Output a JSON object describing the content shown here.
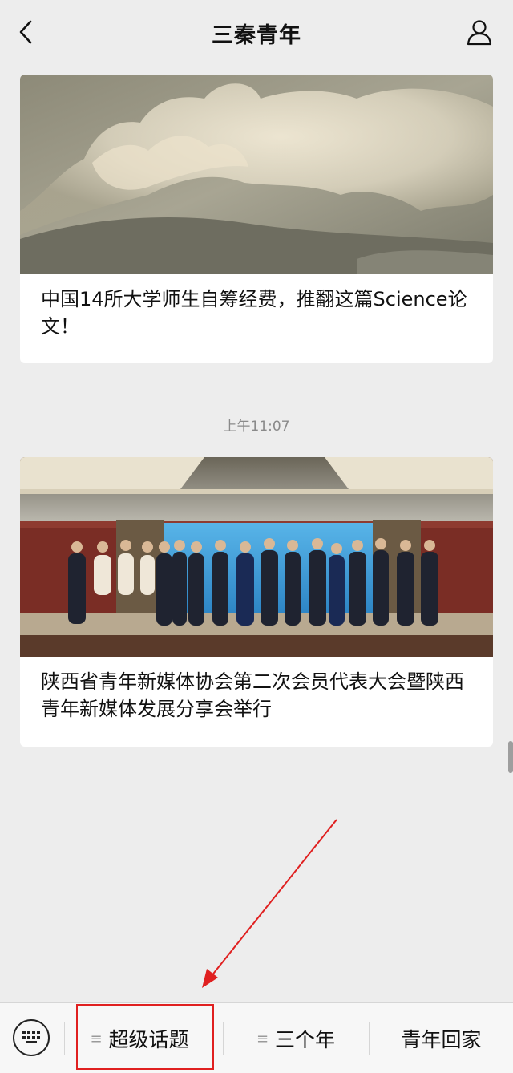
{
  "header": {
    "title": "三秦青年",
    "back_icon": "chevron-left-icon",
    "profile_icon": "person-icon"
  },
  "articles": [
    {
      "title": "中国14所大学师生自筹经费，推翻这篇Science论文！",
      "image": "cloud-photo"
    },
    {
      "title": "陕西省青年新媒体协会第二次会员代表大会暨陕西青年新媒体发展分享会举行",
      "image": "group-photo"
    }
  ],
  "timestamp": "上午11:07",
  "bottom_menu": {
    "keyboard_icon": "keyboard-icon",
    "items": [
      {
        "label": "超级话题",
        "icon": "≡"
      },
      {
        "label": "三个年",
        "icon": "≡"
      },
      {
        "label": "青年回家",
        "icon": ""
      }
    ]
  },
  "colors": {
    "background": "#ededed",
    "card": "#ffffff",
    "highlight": "#e02020"
  }
}
